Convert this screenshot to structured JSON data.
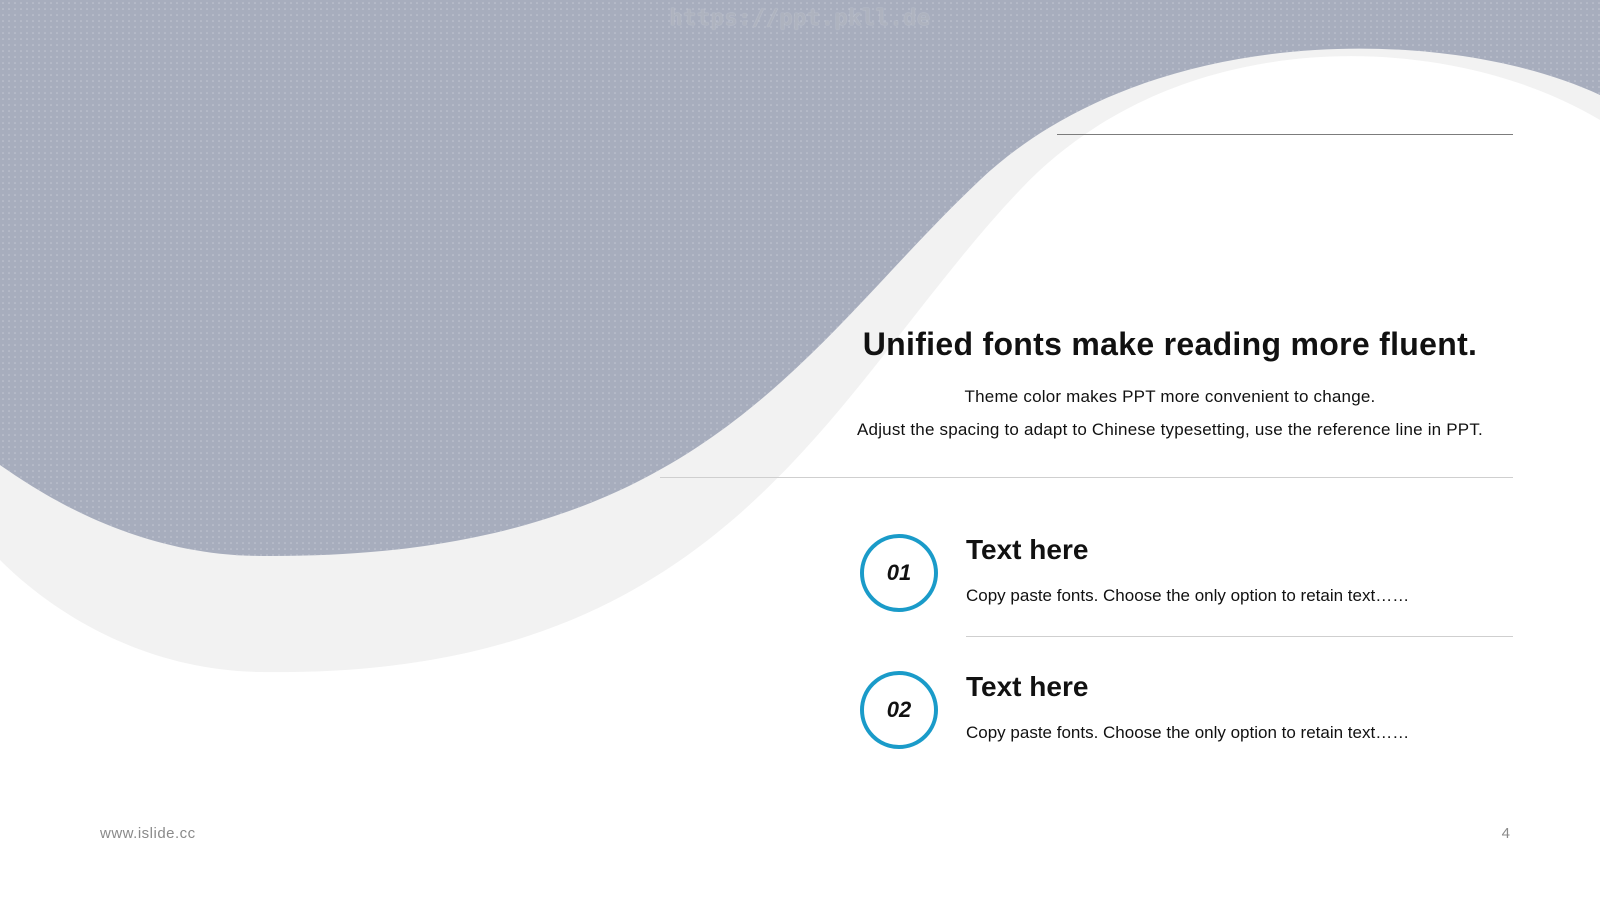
{
  "watermark": "https://ppt.pkll.de",
  "headline": "Unified fonts make reading more fluent.",
  "sublines": [
    "Theme color makes PPT more convenient to change.",
    "Adjust the spacing to adapt to Chinese typesetting, use the reference line in PPT."
  ],
  "items": [
    {
      "number": "01",
      "title": "Text here",
      "description": "Copy paste fonts. Choose the only option to retain text……"
    },
    {
      "number": "02",
      "title": "Text here",
      "description": "Copy paste fonts. Choose the only option to retain text……"
    }
  ],
  "footer": {
    "website": "www.islide.cc",
    "page_number": "4"
  },
  "colors": {
    "wave_fill": "#a7adbd",
    "wave_shadow": "#f2f2f2",
    "accent_circle": "#1a9bc9"
  }
}
